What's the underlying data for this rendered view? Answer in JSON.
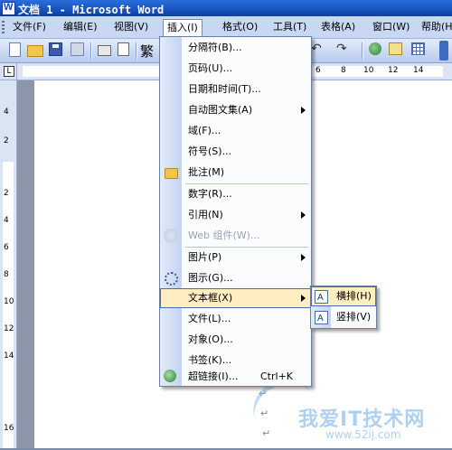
{
  "window": {
    "title": "文档 1 - Microsoft Word"
  },
  "menubar": {
    "items": [
      {
        "label": "文件(F)"
      },
      {
        "label": "编辑(E)"
      },
      {
        "label": "视图(V)"
      },
      {
        "label": "插入(I)"
      },
      {
        "label": "格式(O)"
      },
      {
        "label": "工具(T)"
      },
      {
        "label": "表格(A)"
      },
      {
        "label": "窗口(W)"
      },
      {
        "label": "帮助(H)"
      }
    ]
  },
  "toolbar": {
    "fan_label": "繁"
  },
  "ruler": {
    "corner_label": "L",
    "h_numbers": [
      "6",
      "8",
      "10",
      "12",
      "14"
    ],
    "v_numbers": [
      "4",
      "2",
      "2",
      "4",
      "6",
      "8",
      "10",
      "12",
      "14",
      "16"
    ]
  },
  "insert_menu": {
    "items": [
      {
        "label": "分隔符(B)..."
      },
      {
        "label": "页码(U)..."
      },
      {
        "label": "日期和时间(T)..."
      },
      {
        "label": "自动图文集(A)"
      },
      {
        "label": "域(F)..."
      },
      {
        "label": "符号(S)..."
      },
      {
        "label": "批注(M)"
      },
      {
        "label": "数字(R)..."
      },
      {
        "label": "引用(N)"
      },
      {
        "label": "Web 组件(W)..."
      },
      {
        "label": "图片(P)"
      },
      {
        "label": "图示(G)..."
      },
      {
        "label": "文本框(X)"
      },
      {
        "label": "文件(L)..."
      },
      {
        "label": "对象(O)..."
      },
      {
        "label": "书签(K)..."
      },
      {
        "label": "超链接(I)...",
        "shortcut": "Ctrl+K"
      }
    ]
  },
  "textbox_submenu": {
    "items": [
      {
        "label": "横排(H)"
      },
      {
        "label": "竖排(V)"
      }
    ]
  },
  "document": {
    "para_mark": "↵"
  },
  "watermark": {
    "text": "我爱IT技术网",
    "url": "www.52ij.com"
  }
}
